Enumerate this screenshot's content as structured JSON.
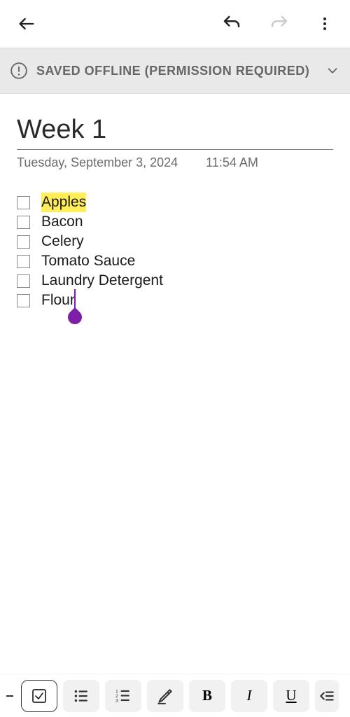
{
  "banner": {
    "message": "SAVED OFFLINE (PERMISSION REQUIRED)"
  },
  "note": {
    "title": "Week 1",
    "date": "Tuesday, September 3, 2024",
    "time": "11:54 AM",
    "items": [
      {
        "text": "Apples",
        "checked": false,
        "highlight": "yellow"
      },
      {
        "text": "Bacon",
        "checked": false
      },
      {
        "text": "Celery",
        "checked": false
      },
      {
        "text": "Tomato Sauce",
        "checked": false
      },
      {
        "text": "Laundry Detergent",
        "checked": false
      },
      {
        "text": "Flour",
        "checked": false,
        "cursor_after": true
      }
    ]
  },
  "colors": {
    "cursor": "#7e1fa8",
    "highlight_yellow": "#ffee58"
  }
}
